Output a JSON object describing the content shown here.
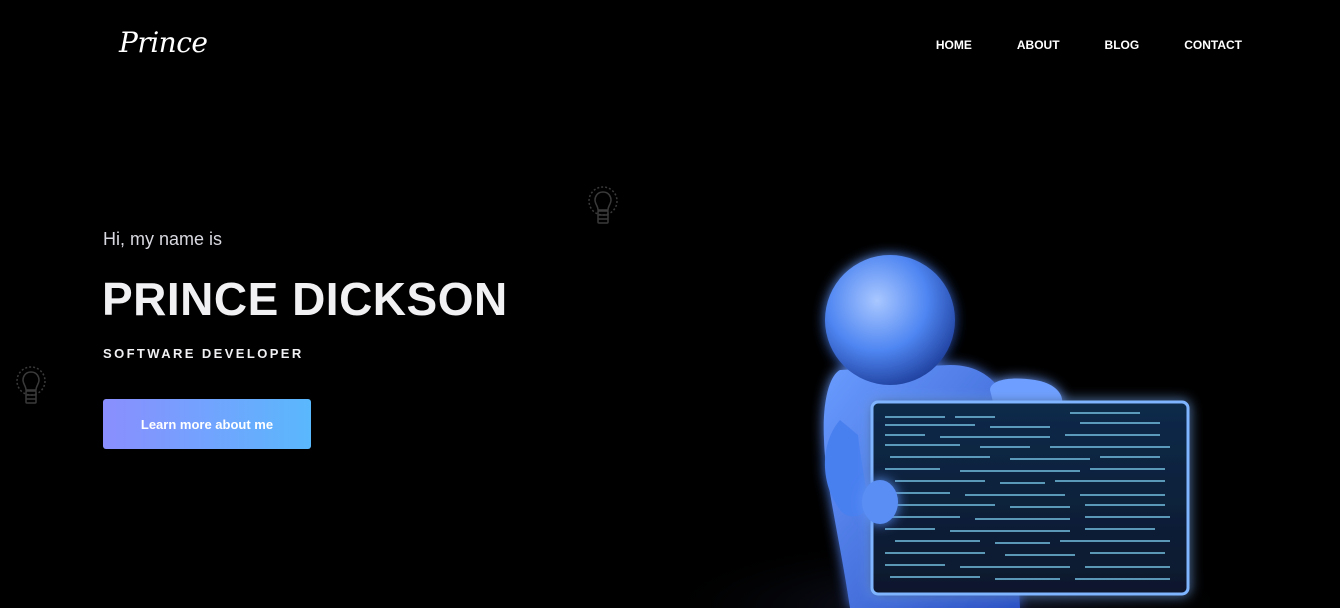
{
  "brand": {
    "logo_text": "Prince"
  },
  "nav": {
    "items": [
      {
        "label": "HOME"
      },
      {
        "label": "ABOUT"
      },
      {
        "label": "BLOG"
      },
      {
        "label": "CONTACT"
      }
    ]
  },
  "hero": {
    "greeting": "Hi, my name is",
    "name": "PRINCE DICKSON",
    "role": "SOFTWARE DEVELOPER",
    "cta_label": "Learn more about me"
  },
  "decor": {
    "bulb_icon": "lightbulb-icon",
    "hero_image": "3d-figure-holding-code-screen",
    "accent_colors": [
      "#8a8efe",
      "#5ab8fd"
    ]
  }
}
